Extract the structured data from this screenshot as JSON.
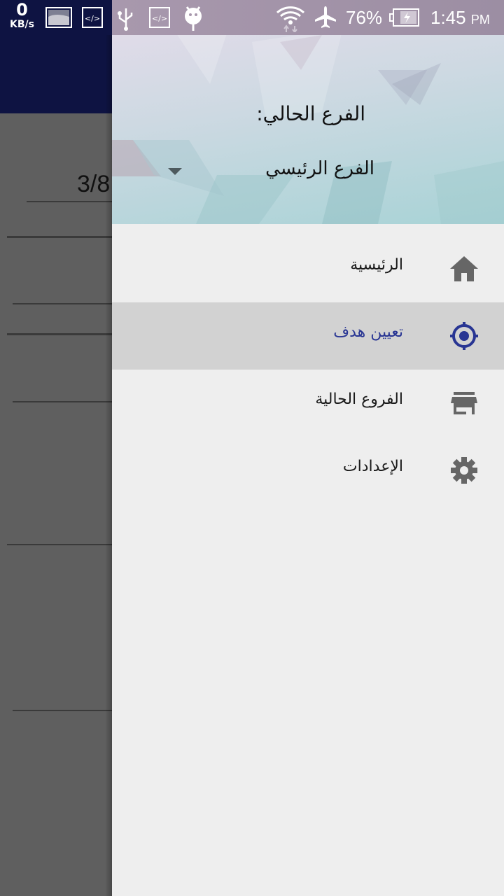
{
  "status_bar": {
    "net_speed_value": "0",
    "net_speed_unit": "KB/s",
    "battery_percent": "76%",
    "time": "1:45",
    "time_suffix": "PM",
    "icons": [
      "image-icon",
      "code-icon",
      "usb-icon",
      "code-icon",
      "android-icon",
      "wifi-icon",
      "airplane-icon",
      "battery-charging-icon"
    ]
  },
  "background": {
    "fraction_value": "3/8"
  },
  "drawer": {
    "current_branch_label": "الفرع الحالي:",
    "selected_branch": "الفرع الرئيسي",
    "items": [
      {
        "label": "الرئيسية",
        "icon": "home-icon",
        "selected": false
      },
      {
        "label": "تعيين هدف",
        "icon": "target-icon",
        "selected": true
      },
      {
        "label": "الفروع الحالية",
        "icon": "store-icon",
        "selected": false
      },
      {
        "label": "الإعدادات",
        "icon": "gear-icon",
        "selected": false
      }
    ],
    "colors": {
      "selected_text": "#283593",
      "icon": "#666666",
      "selected_bg": "#d2d2d2"
    }
  }
}
